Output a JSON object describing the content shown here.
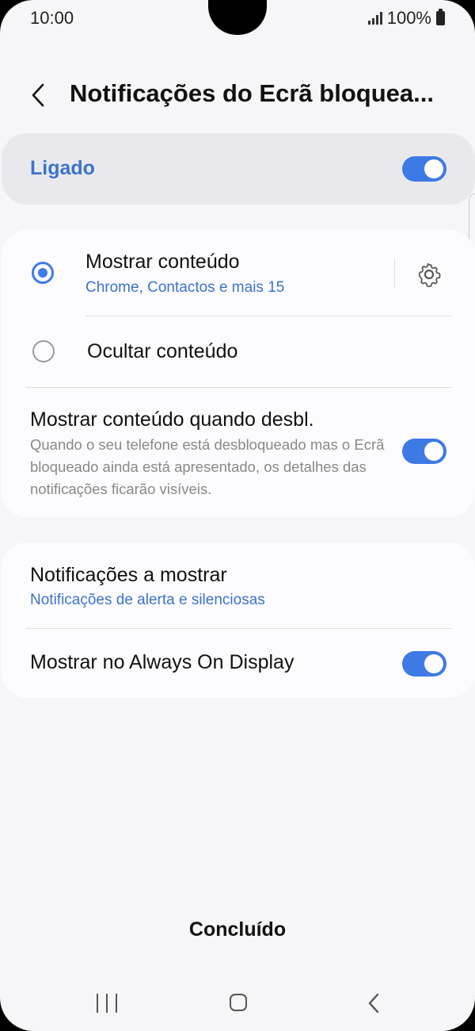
{
  "status_bar": {
    "time": "10:00",
    "battery": "100%"
  },
  "header": {
    "title": "Notificações do Ecrã bloquea..."
  },
  "master_switch": {
    "label": "Ligado",
    "enabled": true
  },
  "content_options": {
    "show": {
      "title": "Mostrar conteúdo",
      "subtitle": "Chrome, Contactos e mais 15",
      "selected": true
    },
    "hide": {
      "title": "Ocultar conteúdo",
      "selected": false
    },
    "show_unlocked": {
      "title": "Mostrar conteúdo quando desbl.",
      "description": "Quando o seu telefone está desbloqueado mas o Ecrã bloqueado ainda está apresentado, os detalhes das notificações ficarão visíveis.",
      "enabled": true
    }
  },
  "display_options": {
    "notifications_to_show": {
      "title": "Notificações a mostrar",
      "subtitle": "Notificações de alerta e silenciosas"
    },
    "always_on_display": {
      "title": "Mostrar no Always On Display",
      "enabled": true
    }
  },
  "done_label": "Concluído",
  "colors": {
    "accent": "#3e7ae6",
    "link_text": "#3d72cc",
    "background": "#f6f6f8"
  }
}
